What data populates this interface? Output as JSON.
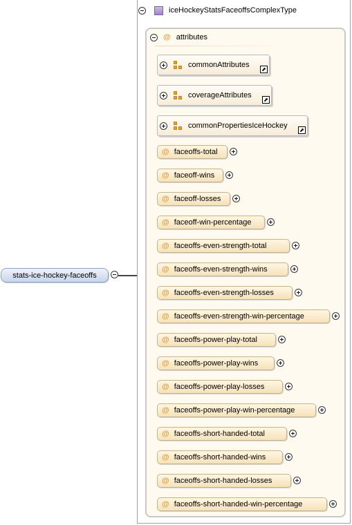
{
  "root_element": {
    "label": "stats-ice-hockey-faceoffs"
  },
  "complex_type": {
    "label": "iceHockeyStatsFaceoffsComplexType"
  },
  "attributes_group": {
    "label": "attributes",
    "at_symbol": "@"
  },
  "attribute_groups": [
    {
      "label": "commonAttributes",
      "link_glyph": "⬈"
    },
    {
      "label": "coverageAttributes",
      "link_glyph": "⬈"
    },
    {
      "label": "commonPropertiesIceHockey",
      "link_glyph": "⬈"
    }
  ],
  "attributes": [
    {
      "label": "faceoffs-total"
    },
    {
      "label": "faceoff-wins"
    },
    {
      "label": "faceoff-losses"
    },
    {
      "label": "faceoff-win-percentage"
    },
    {
      "label": "faceoffs-even-strength-total"
    },
    {
      "label": "faceoffs-even-strength-wins"
    },
    {
      "label": "faceoffs-even-strength-losses"
    },
    {
      "label": "faceoffs-even-strength-win-percentage"
    },
    {
      "label": "faceoffs-power-play-total"
    },
    {
      "label": "faceoffs-power-play-wins"
    },
    {
      "label": "faceoffs-power-play-losses"
    },
    {
      "label": "faceoffs-power-play-win-percentage"
    },
    {
      "label": "faceoffs-short-handed-total"
    },
    {
      "label": "faceoffs-short-handed-wins"
    },
    {
      "label": "faceoffs-short-handed-losses"
    },
    {
      "label": "faceoffs-short-handed-win-percentage"
    }
  ],
  "colors": {
    "attribute_fill": "#f6e2b8",
    "attribute_at": "#e2a03a",
    "root_fill": "#c7d5ec",
    "complex_type_icon": "#9f85cc"
  },
  "icons": {
    "expand": "plus-circle-icon",
    "collapse": "minus-circle-icon",
    "attribute_group": "attribute-group-icon",
    "complex_type": "complex-type-icon",
    "link": "link-arrow-icon"
  }
}
